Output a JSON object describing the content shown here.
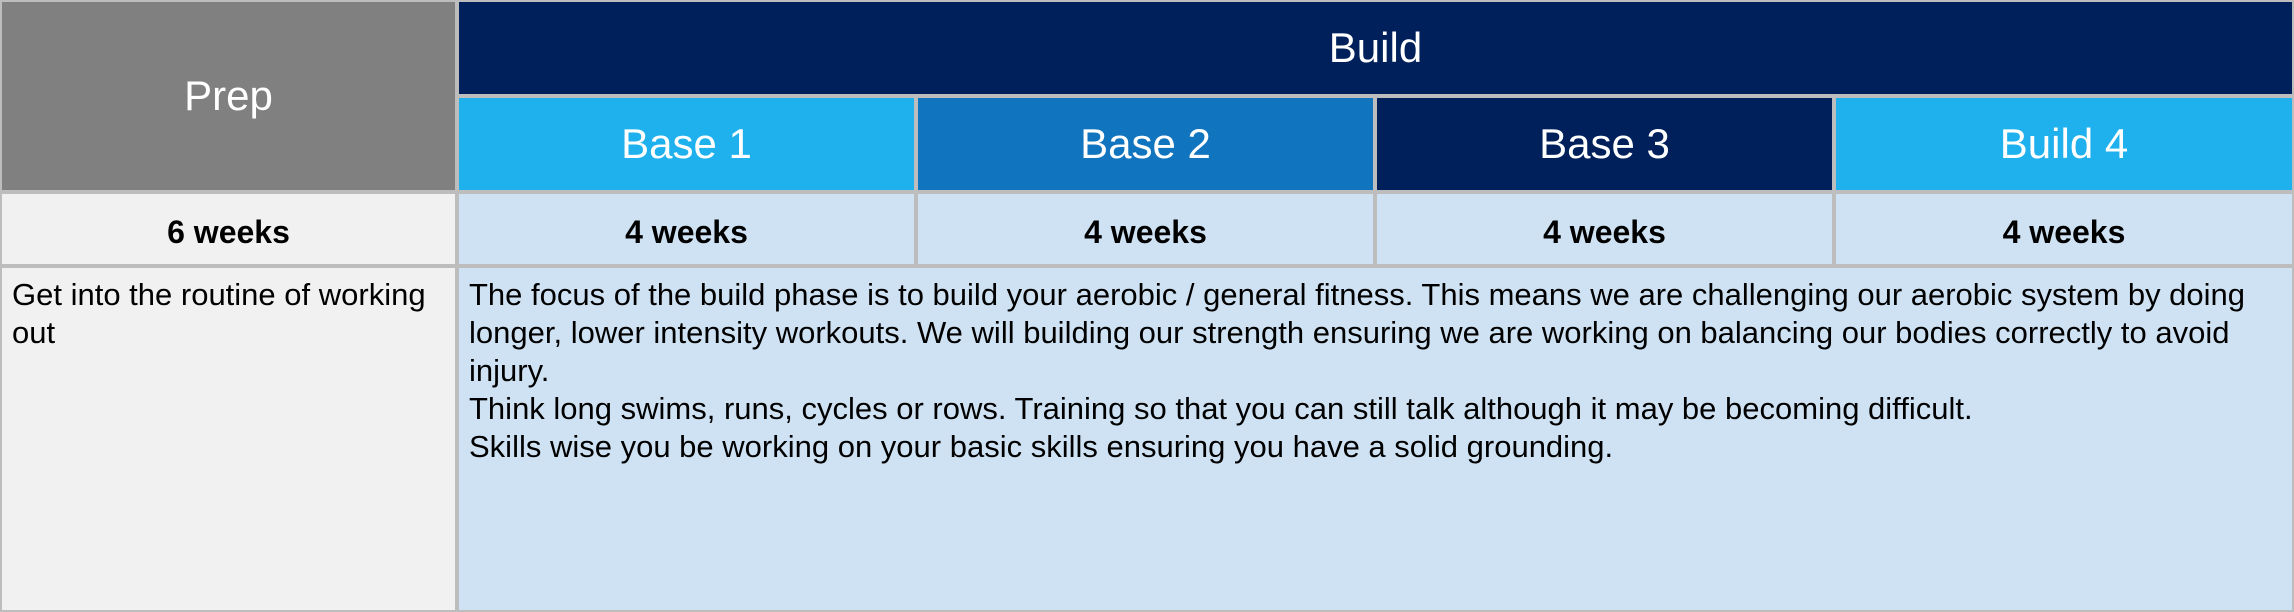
{
  "table": {
    "prep_header": "Prep",
    "build_header": "Build",
    "phases": [
      {
        "label": "Base 1",
        "color": "#1eb1ed"
      },
      {
        "label": "Base 2",
        "color": "#1174be"
      },
      {
        "label": "Base 3",
        "color": "#00205b"
      },
      {
        "label": "Build 4",
        "color": "#1eb1ed"
      }
    ],
    "durations": {
      "prep": "6 weeks",
      "phases": [
        "4 weeks",
        "4 weeks",
        "4 weeks",
        "4 weeks"
      ]
    },
    "descriptions": {
      "prep": "Get into the routine of working out",
      "build": "The focus of the build phase is to build your aerobic / general fitness.  This means we are challenging our aerobic system by doing longer, lower intensity workouts.  We will building our strength ensuring we are working on balancing our bodies correctly to avoid injury.\nThink long swims, runs, cycles or rows.  Training so that you can still talk although it may be becoming difficult.\nSkills wise you be working on your basic skills ensuring you have a solid grounding."
    }
  }
}
